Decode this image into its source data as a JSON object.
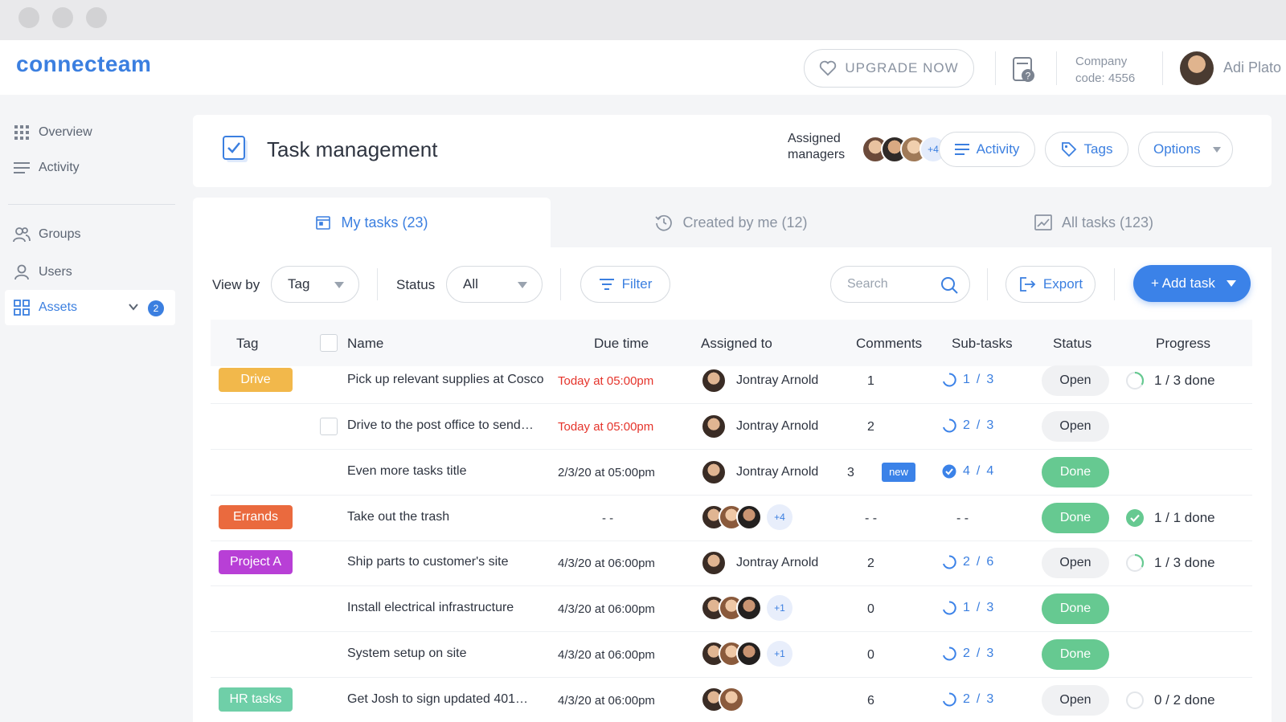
{
  "header": {
    "logo": "connecteam",
    "upgrade_label": "UPGRADE NOW",
    "company_line1": "Company",
    "company_line2": "code: 4556",
    "user_name": "Adi Plato"
  },
  "sidebar": {
    "items": [
      {
        "label": "Overview",
        "icon": "grid-icon"
      },
      {
        "label": "Activity",
        "icon": "lines-icon"
      },
      {
        "label": "Groups",
        "icon": "groups-icon"
      },
      {
        "label": "Users",
        "icon": "user-icon"
      },
      {
        "label": "Assets",
        "icon": "assets-icon",
        "badge": "2",
        "active": true
      }
    ]
  },
  "title_card": {
    "title": "Task management",
    "assigned_line1": "Assigned",
    "assigned_line2": "managers",
    "managers_more": "+4",
    "activity_label": "Activity",
    "tags_label": "Tags",
    "options_label": "Options"
  },
  "tabs": [
    {
      "label": "My tasks (23)",
      "active": true
    },
    {
      "label": "Created by me (12)",
      "active": false
    },
    {
      "label": "All tasks (123)",
      "active": false
    }
  ],
  "toolbar": {
    "view_by_label": "View by",
    "view_by_value": "Tag",
    "status_label": "Status",
    "status_value": "All",
    "filter_label": "Filter",
    "search_placeholder": "Search",
    "export_label": "Export",
    "add_task_label": "+ Add task"
  },
  "table": {
    "columns": {
      "tag": "Tag",
      "name": "Name",
      "due": "Due time",
      "assigned": "Assigned to",
      "comments": "Comments",
      "subtasks": "Sub-tasks",
      "status": "Status",
      "progress": "Progress"
    },
    "rows": [
      {
        "tag": "Drive",
        "tag_color": "#f2b84b",
        "name": "Pick up relevant supplies at Cosco",
        "due": "Today at 05:00pm",
        "due_overdue": true,
        "assignee": "Jontray Arnold",
        "comments": "1",
        "sub_done": "1",
        "sub_total": "3",
        "status": "Open",
        "progress": "1 / 3 done",
        "progress_fraction": 0.33
      },
      {
        "tag": "",
        "name": "Drive to the post office to send…",
        "due": "Today at 05:00pm",
        "due_overdue": true,
        "assignee": "Jontray Arnold",
        "comments": "2",
        "sub_done": "2",
        "sub_total": "3",
        "status": "Open",
        "progress": ""
      },
      {
        "tag": "",
        "name": "Even more tasks title",
        "due": "2/3/20 at 05:00pm",
        "assignee": "Jontray Arnold",
        "comments": "3",
        "new_badge": "new",
        "sub_done": "4",
        "sub_total": "4",
        "status": "Done",
        "progress": ""
      },
      {
        "tag": "Errands",
        "tag_color": "#ea6a3e",
        "name": "Take out the trash",
        "due": "- -",
        "assignee_more": "+4",
        "comments": "- -",
        "subtasks_empty": "- -",
        "status": "Done",
        "progress": "1 / 1 done",
        "progress_fraction": 1.0
      },
      {
        "tag": "Project A",
        "tag_color": "#b83fd6",
        "name": "Ship parts to customer's site",
        "due": "4/3/20 at 06:00pm",
        "assignee": "Jontray Arnold",
        "comments": "2",
        "sub_done": "2",
        "sub_total": "6",
        "status": "Open",
        "progress": "1 / 3 done",
        "progress_fraction": 0.33
      },
      {
        "tag": "",
        "name": "Install electrical infrastructure",
        "due": "4/3/20 at 06:00pm",
        "assignee_more": "+1",
        "comments": "0",
        "sub_done": "1",
        "sub_total": "3",
        "status": "Done",
        "progress": ""
      },
      {
        "tag": "",
        "name": "System setup on site",
        "due": "4/3/20 at 06:00pm",
        "assignee_more": "+1",
        "comments": "0",
        "sub_done": "2",
        "sub_total": "3",
        "status": "Done",
        "progress": ""
      },
      {
        "tag": "HR tasks",
        "tag_color": "#6fcfa8",
        "name": "Get Josh to sign updated 401…",
        "due": "4/3/20 at 06:00pm",
        "comments": "6",
        "sub_done": "2",
        "sub_total": "3",
        "status": "Open",
        "progress": "0 / 2 done",
        "progress_fraction": 0.0
      }
    ]
  }
}
